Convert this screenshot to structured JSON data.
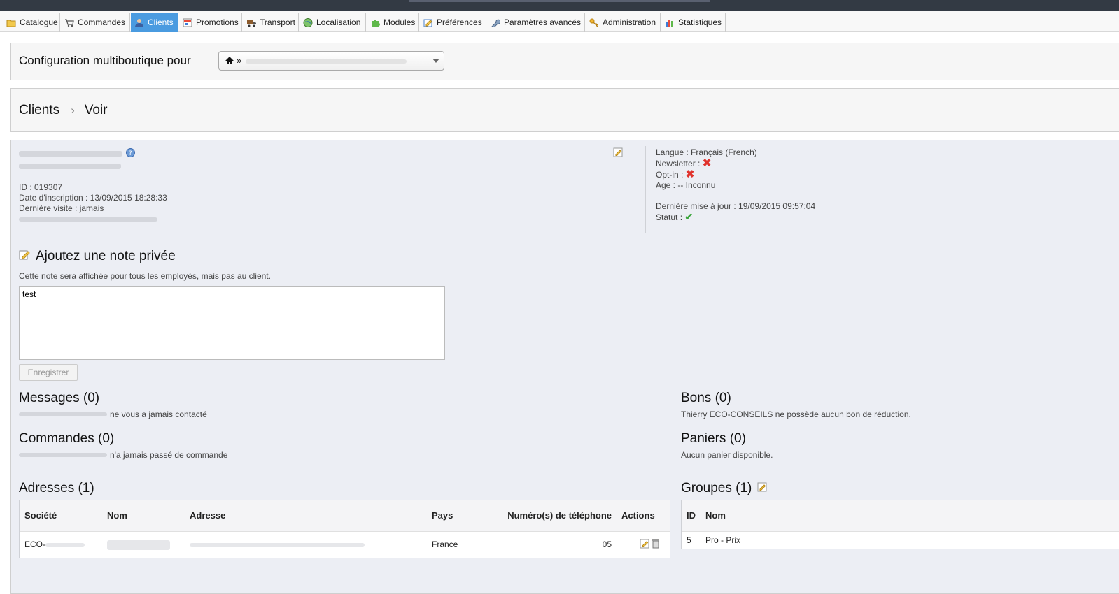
{
  "tabs": [
    {
      "label": "Catalogue",
      "icon": "folder-icon",
      "active": false
    },
    {
      "label": "Commandes",
      "icon": "cart-icon",
      "active": false
    },
    {
      "label": "Clients",
      "icon": "user-icon",
      "active": true
    },
    {
      "label": "Promotions",
      "icon": "promo-icon",
      "active": false
    },
    {
      "label": "Transport",
      "icon": "truck-icon",
      "active": false
    },
    {
      "label": "Localisation",
      "icon": "globe-icon",
      "active": false
    },
    {
      "label": "Modules",
      "icon": "puzzle-icon",
      "active": false
    },
    {
      "label": "Préférences",
      "icon": "preferences-icon",
      "active": false
    },
    {
      "label": "Paramètres avancés",
      "icon": "wrench-icon",
      "active": false
    },
    {
      "label": "Administration",
      "icon": "key-icon",
      "active": false
    },
    {
      "label": "Statistiques",
      "icon": "bar-chart-icon",
      "active": false
    }
  ],
  "multishop": {
    "label": "Configuration multiboutique pour",
    "selected_prefix": "»"
  },
  "breadcrumb": {
    "section": "Clients",
    "page": "Voir"
  },
  "customer": {
    "id": "ID : 019307",
    "registration": "Date d'inscription : 13/09/2015 18:28:33",
    "last_visit": "Dernière visite : jamais",
    "language": "Langue : Français (French)",
    "newsletter": "Newsletter :",
    "optin": "Opt-in :",
    "age": "Age : -- Inconnu",
    "last_update": "Dernière mise à jour : 19/09/2015 09:57:04",
    "status": "Statut :"
  },
  "note": {
    "title": "Ajoutez une note privée",
    "help": "Cette note sera affichée pour tous les employés, mais pas au client.",
    "value": "test",
    "save_label": "Enregistrer"
  },
  "messages": {
    "title": "Messages (0)",
    "text": "ne vous a jamais contacté"
  },
  "orders": {
    "title": "Commandes (0)",
    "text": "n'a jamais passé de commande"
  },
  "vouchers": {
    "title": "Bons (0)",
    "text": "Thierry ECO-CONSEILS ne possède aucun bon de réduction."
  },
  "carts": {
    "title": "Paniers (0)",
    "text": "Aucun panier disponible."
  },
  "addresses": {
    "title": "Adresses (1)",
    "headers": [
      "Société",
      "Nom",
      "Adresse",
      "Pays",
      "Numéro(s) de téléphone",
      "Actions"
    ],
    "row": {
      "company": "ECO-",
      "country": "France",
      "phone": "05"
    }
  },
  "groups": {
    "title": "Groupes (1)",
    "headers": [
      "ID",
      "Nom"
    ],
    "row": {
      "id": "5",
      "name": "Pro - Prix"
    }
  },
  "colors": {
    "accent_tab": "#4a9be0",
    "topbar": "#333a44",
    "panel_bg": "#eceef4"
  }
}
